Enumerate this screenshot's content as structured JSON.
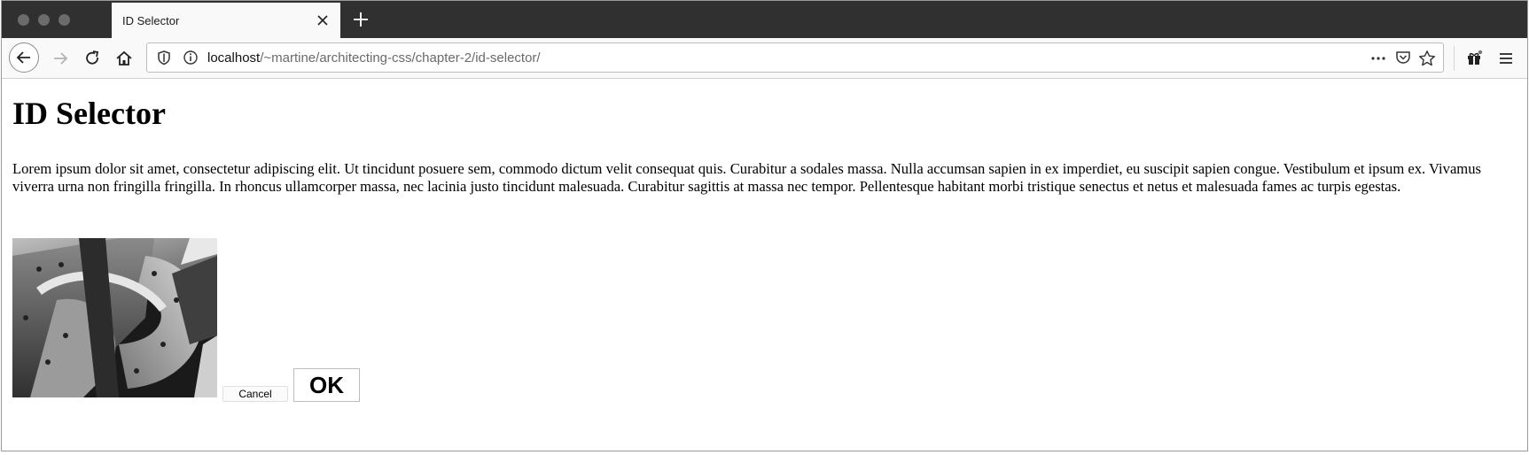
{
  "browser": {
    "tab_title": "ID Selector",
    "url_host": "localhost",
    "url_path": "/~martine/architecting-css/chapter-2/id-selector/",
    "icons": [
      "close-icon",
      "plus-icon",
      "back-arrow-icon",
      "forward-arrow-icon",
      "reload-icon",
      "home-icon",
      "shield-icon",
      "info-icon",
      "more-icon",
      "pocket-icon",
      "star-icon",
      "gift-icon",
      "menu-icon"
    ]
  },
  "page": {
    "heading": "ID Selector",
    "paragraph": "Lorem ipsum dolor sit amet, consectetur adipiscing elit. Ut tincidunt posuere sem, commodo dictum velit consequat quis. Curabitur a sodales massa. Nulla accumsan sapien in ex imperdiet, eu suscipit sapien congue. Vestibulum et ipsum ex. Vivamus viverra urna non fringilla fringilla. In rhoncus ullamcorper massa, nec lacinia justo tincidunt malesuada. Curabitur sagittis at massa nec tempor. Pellentesque habitant morbi tristique senectus et netus et malesuada fames ac turpis egestas.",
    "cancel_label": "Cancel",
    "ok_label": "OK"
  }
}
